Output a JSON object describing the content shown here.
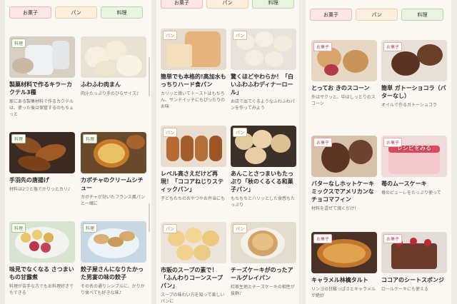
{
  "panels": [
    {
      "tabs": [
        "お菓子",
        "パン",
        "料理"
      ],
      "cards": [
        {
          "badge": "料理",
          "title": "製菓材料で作るキラーカクテル3種",
          "desc": "家にある製菓材料で作るカクテルは、使った後は保管するのもちょっと"
        },
        {
          "badge": "",
          "title": "ふわふわ肉まん",
          "desc": "肉汁たっぷり手のひらサイズ♪"
        },
        {
          "badge": "料理",
          "title": "手羽先の唐揚げ",
          "desc": "材料は2つと塩でかりっとカリ♪"
        },
        {
          "badge": "料理",
          "title": "カボチャのクリームシチュー",
          "desc": "カボチャが効いたフランス風パンと一緒に"
        },
        {
          "badge": "料理",
          "title": "味見でなくなる さつまいもの甘露煮",
          "desc": "料理が苦手な方でもお料理好きでもできる"
        },
        {
          "badge": "料理",
          "title": "餃子屋さんになりたかった男宴の味の餃子",
          "desc": "その名の通りシンプルに、かりかり食べても好きな味♪"
        }
      ]
    },
    {
      "tabs": [
        "お菓子",
        "パン",
        "料理"
      ],
      "cards": [
        {
          "badge": "パン",
          "title": "簡単でも本格的!高加水もっちりハード食パン",
          "desc": "カリッと焼いてトーストはもちろん、サンドイッチにもぴったりのお味"
        },
        {
          "badge": "パン",
          "title": "驚くほどやわらか！「白いふわふわディナーロール」",
          "desc": "お店で出てくるようなふわふわパンを作ってみよう"
        },
        {
          "badge": "パン",
          "title": "レベル高さえだけど再現！「ココアねじりスティックパン」",
          "desc": "子どもたちのおやつやお弁当にも"
        },
        {
          "badge": "パン",
          "title": "あんことさつまいもたっぷり「秋のくるくる和菓子パン」",
          "desc": "もちもちとハリッとした食感もたっぷり"
        },
        {
          "badge": "パン",
          "title": "市販のスープの素で！「ふんわりコーンスープパン」",
          "desc": "スープの味わい方を知って楽しいパンに"
        },
        {
          "badge": "パン",
          "title": "チーズケーキがのったアールグレイパン",
          "desc": "紅茶生地とチーズケーキの相性が抜群♪"
        }
      ]
    },
    {
      "tabs": [
        "お菓子",
        "パン",
        "料理"
      ],
      "cards": [
        {
          "badge": "お菓子",
          "title": "とってお きのスコーン",
          "desc": "外はサクッと、中はしっとりのスコーン"
        },
        {
          "badge": "お菓子",
          "title": "簡単 ガトーショコラ（バターなし）",
          "desc": "オイルで作るガトーショコラ"
        },
        {
          "badge": "お菓子",
          "title": "バターなしホットケーキミックスでアメリカンなチョコマフィン",
          "desc": "材料を混ぜて焼くだけ！"
        },
        {
          "badge": "お菓子",
          "title": "苺のムースケーキ",
          "desc": "苺のピューレをたっぷり使って",
          "overlay": "レシピをみる"
        },
        {
          "badge": "お菓子",
          "title": "キャラメル林檎タルト",
          "desc": "リンゴの甘酸っぱさとキャラメルが絶妙"
        },
        {
          "badge": "お菓子",
          "title": "ココアのシートスポンジ",
          "desc": "ロールケーキにも使える"
        }
      ]
    }
  ],
  "colors": {
    "panel_bg": "#fbf8f3",
    "page_bg": "#eeeae4"
  }
}
